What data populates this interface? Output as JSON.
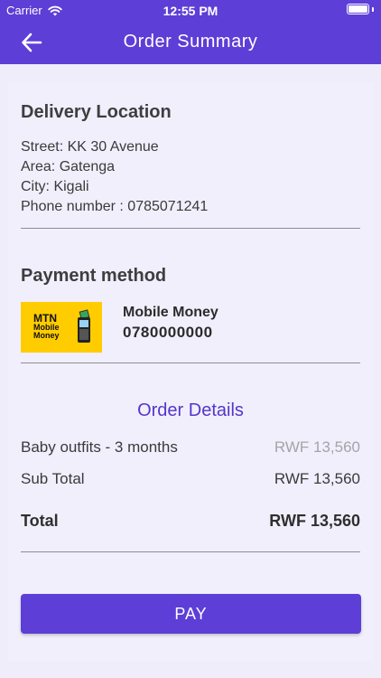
{
  "status_bar": {
    "carrier": "Carrier",
    "time": "12:55 PM"
  },
  "header": {
    "title": "Order Summary"
  },
  "delivery": {
    "title": "Delivery Location",
    "street": "Street: KK 30 Avenue",
    "area": "Area: Gatenga",
    "city": "City: Kigali",
    "phone": "Phone number : 0785071241"
  },
  "payment": {
    "title": "Payment method",
    "logo_line1": "MTN",
    "logo_line2": "Mobile",
    "logo_line3": "Money",
    "method_name": "Mobile Money",
    "method_number": "0780000000"
  },
  "order": {
    "title": "Order Details",
    "item_name": "Baby outfits - 3 months",
    "item_price": "RWF 13,560",
    "subtotal_label": "Sub Total",
    "subtotal_value": "RWF 13,560",
    "total_label": "Total",
    "total_value": "RWF 13,560"
  },
  "actions": {
    "pay_label": "PAY"
  },
  "colors": {
    "primary": "#5d3ed6",
    "background": "#efedfa",
    "mtn_yellow": "#ffcc00"
  }
}
